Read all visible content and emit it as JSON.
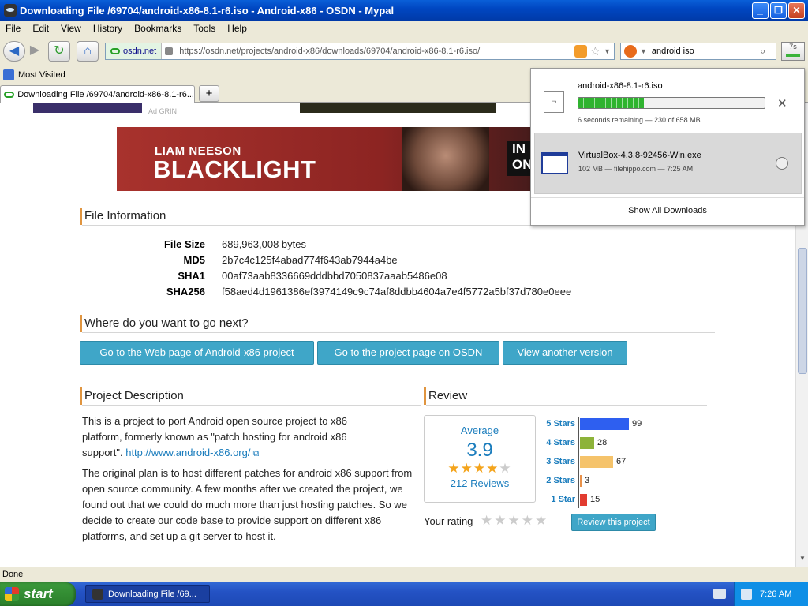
{
  "window": {
    "title": "Downloading File /69704/android-x86-8.1-r6.iso - Android-x86 - OSDN - Mypal"
  },
  "menu": [
    "File",
    "Edit",
    "View",
    "History",
    "Bookmarks",
    "Tools",
    "Help"
  ],
  "nav": {
    "site": "osdn.net",
    "url": "https://osdn.net/projects/android-x86/downloads/69704/android-x86-8.1-r6.iso/",
    "search_value": "android iso",
    "download_btn_label": "7s"
  },
  "bookmarks": {
    "most_visited": "Most Visited"
  },
  "tab": {
    "label": "Downloading File /69704/android-x86-8.1-r6..."
  },
  "ads": {
    "tag": "Ad GRIN",
    "banner_line1": "LIAM NEESON",
    "banner_line2": "BLACKLIGHT",
    "banner_side": "IN\nON"
  },
  "file_info": {
    "heading": "File Information",
    "rows": [
      {
        "label": "File Size",
        "value": "689,963,008 bytes"
      },
      {
        "label": "MD5",
        "value": "2b7c4c125f4abad774f643ab7944a4be"
      },
      {
        "label": "SHA1",
        "value": "00af73aab8336669dddbbd7050837aaab5486e08"
      },
      {
        "label": "SHA256",
        "value": "f58aed4d1961386ef3974149c9c74af8ddbb4604a7e4f5772a5bf37d780e0eee"
      }
    ]
  },
  "next": {
    "heading": "Where do you want to go next?",
    "buttons": [
      "Go to the Web page of Android-x86 project",
      "Go to the project page on OSDN",
      "View another version"
    ]
  },
  "project": {
    "heading": "Project Description",
    "p1_text": "This is a project to port Android open source project to x86 platform, formerly known as \"patch hosting for android x86 support\".",
    "p1_link": "http://www.android-x86.org/",
    "p2": "The original plan is to host different patches for android x86 support from open source community. A few months after we created the project, we found out that we could do much more than just hosting patches. So we decide to create our code base to provide support on different x86 platforms, and set up a git server to host it."
  },
  "review": {
    "heading": "Review",
    "average_label": "Average",
    "average_value": "3.9",
    "average_stars": 3.9,
    "reviews_label": "212 Reviews",
    "your_rating": "Your rating",
    "review_button": "Review this project",
    "bars": [
      {
        "label": "5 Stars",
        "count": 99,
        "color": "#2e5ff0"
      },
      {
        "label": "4 Stars",
        "count": 28,
        "color": "#8db33a"
      },
      {
        "label": "3 Stars",
        "count": 67,
        "color": "#f5c36b"
      },
      {
        "label": "2 Stars",
        "count": 3,
        "color": "#e8914a"
      },
      {
        "label": "1 Star",
        "count": 15,
        "color": "#e23c30"
      }
    ]
  },
  "downloads": {
    "items": [
      {
        "name": "android-x86-8.1-r6.iso",
        "meta": "6 seconds remaining — 230 of 658 MB",
        "progress": 0.35
      },
      {
        "name": "VirtualBox-4.3.8-92456-Win.exe",
        "meta": "102 MB — filehippo.com — 7:25 AM"
      }
    ],
    "show_all": "Show All Downloads"
  },
  "status": {
    "text": "Done"
  },
  "taskbar": {
    "start": "start",
    "item": "Downloading File /69...",
    "clock": "7:26 AM"
  }
}
